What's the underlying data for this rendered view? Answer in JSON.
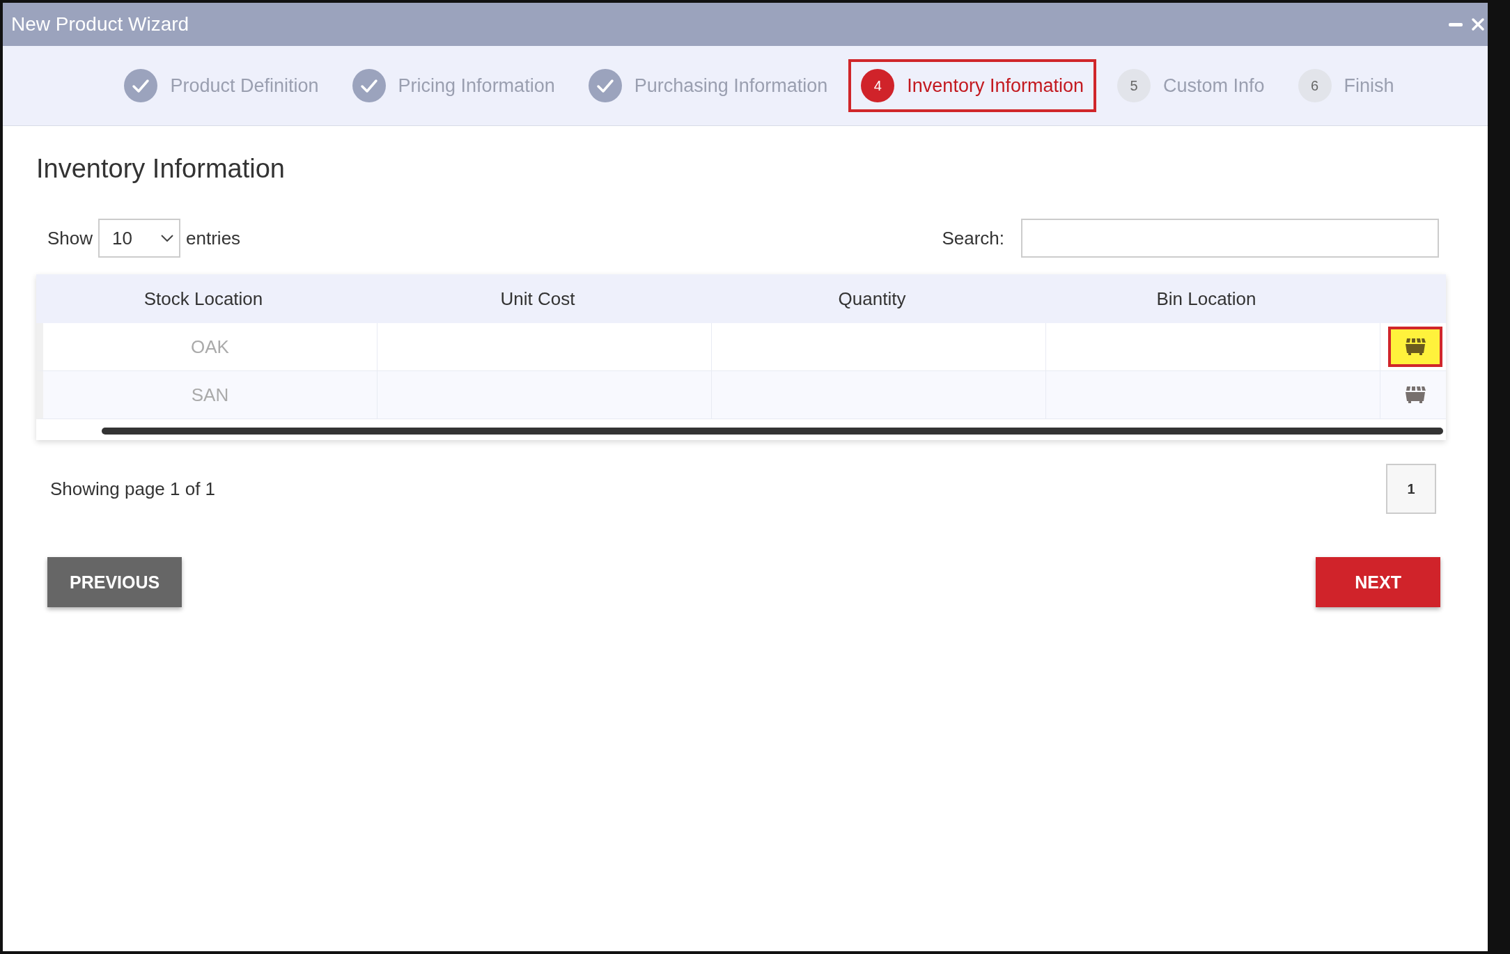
{
  "window": {
    "title": "New Product Wizard"
  },
  "steps": [
    {
      "kind": "done",
      "label": "Product Definition",
      "selected": false
    },
    {
      "kind": "done",
      "label": "Pricing Information",
      "selected": false
    },
    {
      "kind": "done",
      "label": "Purchasing Information",
      "selected": false
    },
    {
      "kind": "current",
      "number": "4",
      "label": "Inventory Information",
      "selected": true
    },
    {
      "kind": "todo",
      "number": "5",
      "label": "Custom Info",
      "selected": false
    },
    {
      "kind": "todo",
      "number": "6",
      "label": "Finish",
      "selected": false
    }
  ],
  "heading": "Inventory Information",
  "length_menu": {
    "before": "Show",
    "value": "10",
    "after": "entries"
  },
  "search": {
    "label": "Search:"
  },
  "table": {
    "columns": [
      "Stock Location",
      "Unit Cost",
      "Quantity",
      "Bin Location"
    ],
    "rows": [
      {
        "stock_location": "OAK",
        "highlighted": true
      },
      {
        "stock_location": "SAN",
        "highlighted": false
      }
    ]
  },
  "pagination": {
    "info": "Showing page 1 of 1",
    "pages": [
      "1"
    ]
  },
  "buttons": {
    "previous": "PREVIOUS",
    "next": "NEXT"
  }
}
